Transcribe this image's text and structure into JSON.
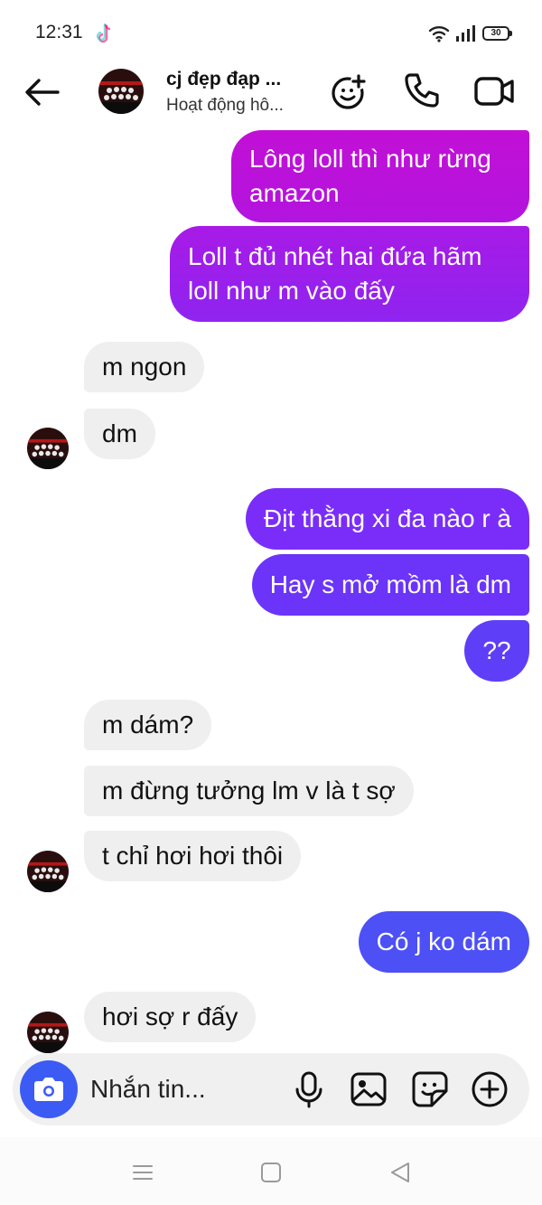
{
  "status_bar": {
    "time": "12:31",
    "battery": "30",
    "icons": [
      "tiktok-icon",
      "wifi-icon",
      "signal-icon",
      "battery-icon"
    ]
  },
  "header": {
    "contact_name": "cj đẹp đạp ...",
    "contact_status": "Hoạt động hô...",
    "icons": [
      "back-arrow-icon",
      "add-emoji-icon",
      "phone-icon",
      "video-icon"
    ]
  },
  "messages": [
    {
      "direction": "outgoing",
      "lines": [
        "Lông loll thì như rừng",
        "amazon"
      ]
    },
    {
      "direction": "outgoing",
      "lines": [
        "Loll t đủ nhét hai đứa hãm",
        "loll như m vào đấy"
      ]
    },
    {
      "direction": "incoming",
      "lines": [
        "m ngon"
      ]
    },
    {
      "direction": "incoming",
      "lines": [
        "dm"
      ]
    },
    {
      "direction": "outgoing",
      "lines": [
        "Địt thằng xi đa nào r à"
      ]
    },
    {
      "direction": "outgoing",
      "lines": [
        "Hay s mở mồm là dm"
      ]
    },
    {
      "direction": "outgoing",
      "lines": [
        "??"
      ]
    },
    {
      "direction": "incoming",
      "lines": [
        "m dám?"
      ]
    },
    {
      "direction": "incoming",
      "lines": [
        "m đừng tưởng lm v là t sợ"
      ]
    },
    {
      "direction": "incoming",
      "lines": [
        "t chỉ hơi hơi thôi"
      ]
    },
    {
      "direction": "outgoing",
      "lines": [
        "Có j ko dám"
      ]
    },
    {
      "direction": "incoming",
      "lines": [
        "hơi sợ r đấy"
      ]
    }
  ],
  "composer": {
    "placeholder": "Nhắn tin...",
    "icons": [
      "camera-icon",
      "microphone-icon",
      "gallery-icon",
      "sticker-icon",
      "plus-icon"
    ]
  },
  "nav_bar": {
    "icons": [
      "recents-icon",
      "home-icon",
      "back-icon"
    ]
  },
  "colors": {
    "outgoing_gradient": [
      "#c010d8",
      "#9a1ef0",
      "#6a35fa",
      "#4e52f5"
    ],
    "incoming_bubble": "#efefef",
    "camera_button": "#3c5bf5"
  }
}
